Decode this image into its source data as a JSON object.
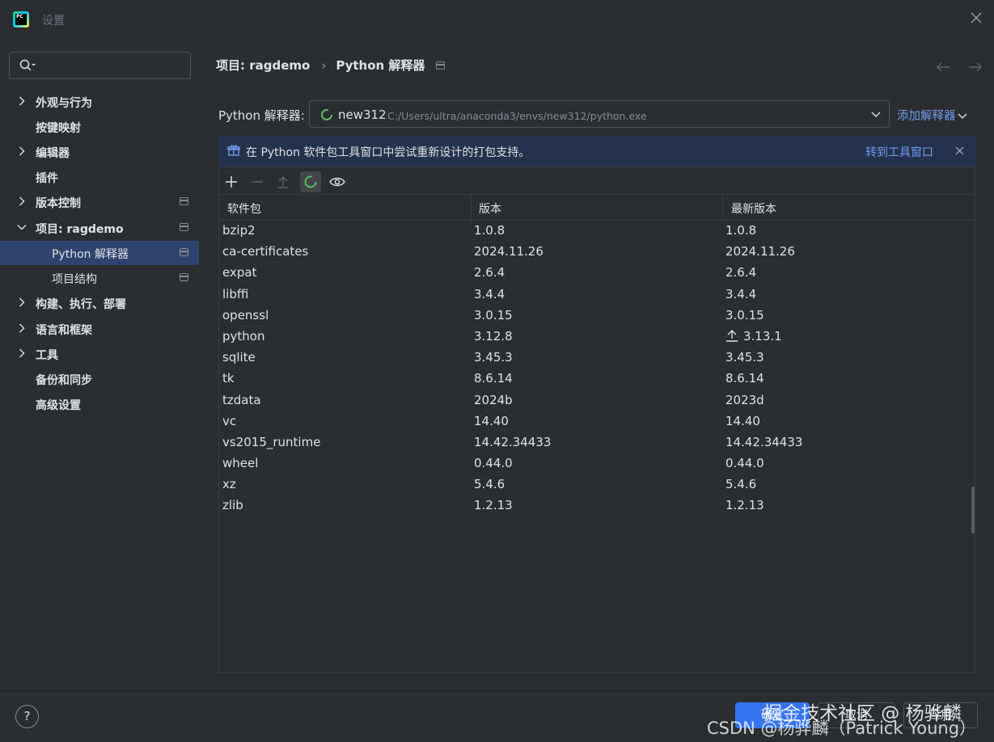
{
  "window": {
    "title": "设置",
    "app_logo_text": "PC"
  },
  "search": {
    "placeholder": "",
    "value": ""
  },
  "sidebar": {
    "items": [
      {
        "label": "外观与行为",
        "expandable": true,
        "pinned": false
      },
      {
        "label": "按键映射",
        "expandable": false,
        "pinned": false
      },
      {
        "label": "编辑器",
        "expandable": true,
        "pinned": false
      },
      {
        "label": "插件",
        "expandable": false,
        "pinned": false
      },
      {
        "label": "版本控制",
        "expandable": true,
        "pinned": true
      },
      {
        "label": "项目: ragdemo",
        "expandable": true,
        "expanded": true,
        "pinned": true
      },
      {
        "label": "Python 解释器",
        "sub": true,
        "selected": true,
        "pinned": true
      },
      {
        "label": "项目结构",
        "sub": true,
        "pinned": true
      },
      {
        "label": "构建、执行、部署",
        "expandable": true,
        "pinned": false
      },
      {
        "label": "语言和框架",
        "expandable": true,
        "pinned": false
      },
      {
        "label": "工具",
        "expandable": true,
        "pinned": false
      },
      {
        "label": "备份和同步",
        "expandable": false,
        "pinned": false
      },
      {
        "label": "高级设置",
        "expandable": false,
        "pinned": false
      }
    ]
  },
  "breadcrumb": {
    "project": "项目: ragdemo",
    "page": "Python 解释器"
  },
  "interpreter": {
    "label": "Python 解释器:",
    "name": "new312",
    "path": "C:/Users/ultra/anaconda3/envs/new312/python.exe",
    "add_label": "添加解释器"
  },
  "banner": {
    "message": "在 Python 软件包工具窗口中尝试重新设计的打包支持。",
    "link": "转到工具窗口"
  },
  "packages": {
    "columns": [
      "软件包",
      "版本",
      "最新版本"
    ],
    "rows": [
      {
        "name": "bzip2",
        "version": "1.0.8",
        "latest": "1.0.8",
        "upgrade": false
      },
      {
        "name": "ca-certificates",
        "version": "2024.11.26",
        "latest": "2024.11.26",
        "upgrade": false
      },
      {
        "name": "expat",
        "version": "2.6.4",
        "latest": "2.6.4",
        "upgrade": false
      },
      {
        "name": "libffi",
        "version": "3.4.4",
        "latest": "3.4.4",
        "upgrade": false
      },
      {
        "name": "openssl",
        "version": "3.0.15",
        "latest": "3.0.15",
        "upgrade": false
      },
      {
        "name": "python",
        "version": "3.12.8",
        "latest": "3.13.1",
        "upgrade": true
      },
      {
        "name": "sqlite",
        "version": "3.45.3",
        "latest": "3.45.3",
        "upgrade": false
      },
      {
        "name": "tk",
        "version": "8.6.14",
        "latest": "8.6.14",
        "upgrade": false
      },
      {
        "name": "tzdata",
        "version": "2024b",
        "latest": "2023d",
        "upgrade": false
      },
      {
        "name": "vc",
        "version": "14.40",
        "latest": "14.40",
        "upgrade": false
      },
      {
        "name": "vs2015_runtime",
        "version": "14.42.34433",
        "latest": "14.42.34433",
        "upgrade": false
      },
      {
        "name": "wheel",
        "version": "0.44.0",
        "latest": "0.44.0",
        "upgrade": false
      },
      {
        "name": "xz",
        "version": "5.4.6",
        "latest": "5.4.6",
        "upgrade": false
      },
      {
        "name": "zlib",
        "version": "1.2.13",
        "latest": "1.2.13",
        "upgrade": false
      }
    ]
  },
  "footer": {
    "help": "?",
    "ok": "确定",
    "cancel": "取消",
    "apply": "应用"
  },
  "watermark": {
    "line1": "掘金技术社区 @ 杨骅麟",
    "line2": "CSDN @杨骅麟（Patrick Young）"
  },
  "colors": {
    "background": "#2b2d30",
    "selected": "#2e436e",
    "accent": "#3574f0",
    "link": "#6f9bf0",
    "banner": "#25324d"
  }
}
